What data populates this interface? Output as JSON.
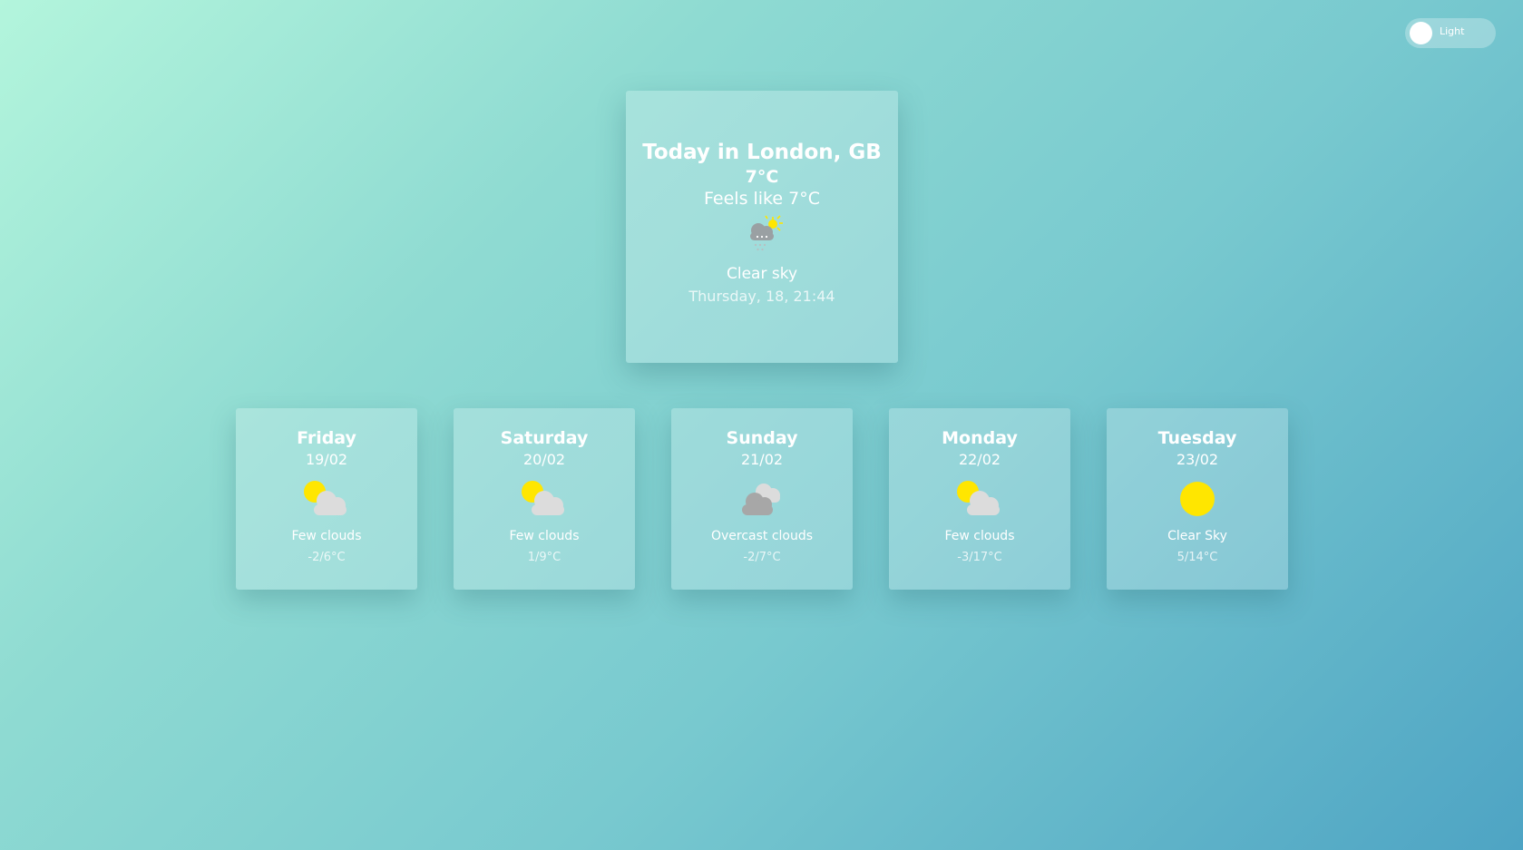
{
  "theme_toggle": {
    "label": "Light"
  },
  "today": {
    "title": "Today in London, GB",
    "temp": "7°C",
    "feels_like": "Feels like 7°C",
    "icon": "snow-cloud-sun-icon",
    "description": "Clear sky",
    "datetime": "Thursday, 18, 21:44"
  },
  "forecast": [
    {
      "day": "Friday",
      "date": "19/02",
      "icon": "few-clouds-icon",
      "description": "Few clouds",
      "range": "-2/6°C"
    },
    {
      "day": "Saturday",
      "date": "20/02",
      "icon": "few-clouds-icon",
      "description": "Few clouds",
      "range": "1/9°C"
    },
    {
      "day": "Sunday",
      "date": "21/02",
      "icon": "overcast-clouds-icon",
      "description": "Overcast clouds",
      "range": "-2/7°C"
    },
    {
      "day": "Monday",
      "date": "22/02",
      "icon": "few-clouds-icon",
      "description": "Few clouds",
      "range": "-3/17°C"
    },
    {
      "day": "Tuesday",
      "date": "23/02",
      "icon": "clear-sky-icon",
      "description": "Clear Sky",
      "range": "5/14°C"
    }
  ],
  "colors": {
    "sun": "#ffe600",
    "cloud_light": "#dcdcdc",
    "cloud_dark": "#a7a7a7"
  }
}
